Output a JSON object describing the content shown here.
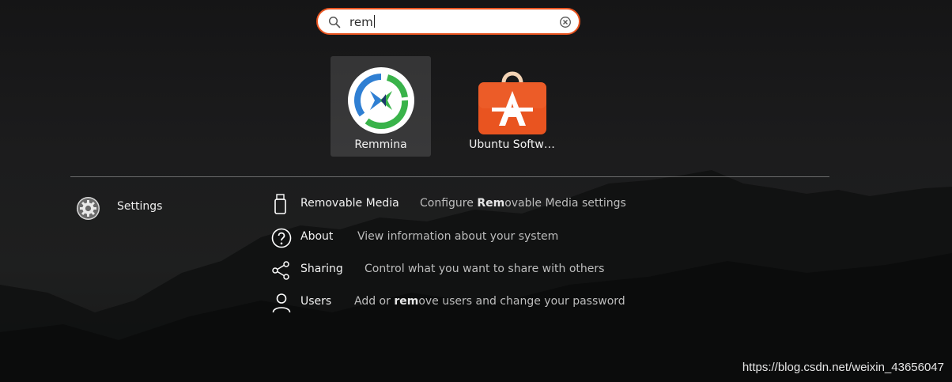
{
  "search": {
    "value": "rem"
  },
  "apps": [
    {
      "label": "Remmina",
      "icon": "remmina-icon",
      "selected": true
    },
    {
      "label": "Ubuntu Softw…",
      "icon": "ubuntu-software-icon",
      "selected": false
    }
  ],
  "provider": {
    "name": "Settings",
    "icon": "settings-gear-icon"
  },
  "results": [
    {
      "title": "Removable Media",
      "icon": "removable-media-icon",
      "desc_pre": "Configure ",
      "desc_bold": "Rem",
      "desc_post": "ovable Media settings"
    },
    {
      "title": "About",
      "icon": "about-question-icon",
      "desc_pre": "View information about your system",
      "desc_bold": "",
      "desc_post": ""
    },
    {
      "title": "Sharing",
      "icon": "sharing-icon",
      "desc_pre": "Control what you want to share with others",
      "desc_bold": "",
      "desc_post": ""
    },
    {
      "title": "Users",
      "icon": "user-icon",
      "desc_pre": "Add or ",
      "desc_bold": "rem",
      "desc_post": "ove users and change your password"
    }
  ],
  "watermark": "https://blog.csdn.net/weixin_43656047",
  "colors": {
    "accent": "#e95420",
    "remmina_blue": "#2f7fd3",
    "remmina_green": "#39b34a"
  }
}
